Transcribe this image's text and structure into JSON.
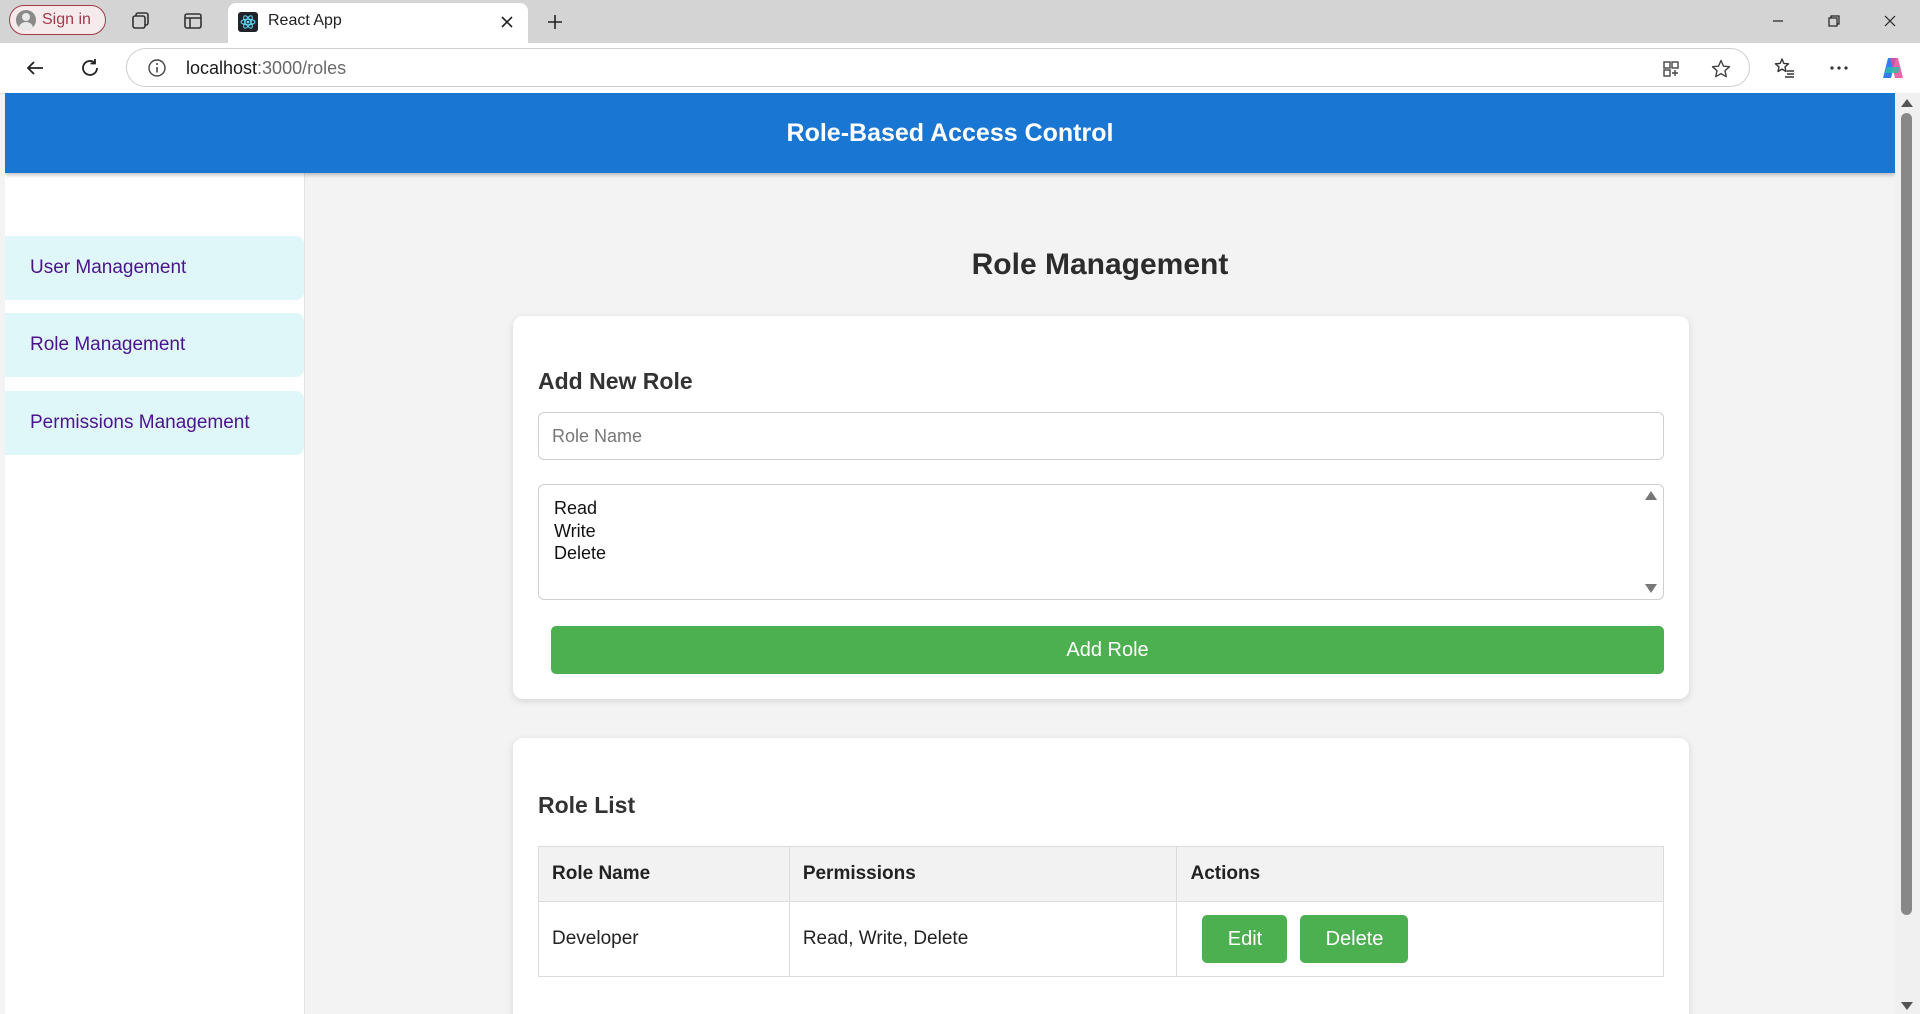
{
  "browser": {
    "signin_label": "Sign in",
    "tab_title": "React App",
    "url_host": "localhost",
    "url_path": ":3000/roles"
  },
  "app": {
    "header_title": "Role-Based Access Control"
  },
  "sidebar": {
    "items": [
      {
        "label": "User Management"
      },
      {
        "label": "Role Management"
      },
      {
        "label": "Permissions Management"
      }
    ]
  },
  "page": {
    "title": "Role Management",
    "add_card": {
      "heading": "Add New Role",
      "role_name_placeholder": "Role Name",
      "role_name_value": "",
      "permission_options": [
        "Read",
        "Write",
        "Delete"
      ],
      "submit_label": "Add Role"
    },
    "list_card": {
      "heading": "Role List",
      "columns": [
        "Role Name",
        "Permissions",
        "Actions"
      ],
      "rows": [
        {
          "name": "Developer",
          "permissions": "Read, Write, Delete",
          "edit_label": "Edit",
          "delete_label": "Delete"
        }
      ]
    }
  },
  "colors": {
    "header_bg": "#1976d2",
    "sidebar_item_bg": "#e0f7fa",
    "sidebar_item_text": "#4a148c",
    "button_green": "#4caf50"
  },
  "icons": [
    "profile-icon",
    "workspaces-icon",
    "tab-actions-icon",
    "react-favicon",
    "close-icon",
    "plus-icon",
    "minimize-icon",
    "restore-icon",
    "window-close-icon",
    "back-icon",
    "refresh-icon",
    "info-icon",
    "app-available-icon",
    "favorite-star-icon",
    "favorites-icon",
    "more-icon",
    "copilot-icon"
  ]
}
